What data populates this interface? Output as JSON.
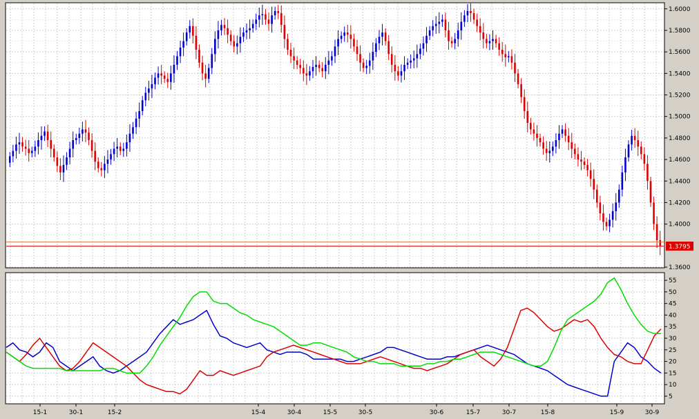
{
  "chart_data": [
    {
      "type": "candlestick",
      "title": "",
      "ylim": [
        1.36,
        1.605
      ],
      "yticks": [
        "1.6000",
        "1.5800",
        "1.5600",
        "1.5400",
        "1.5200",
        "1.5000",
        "1.4800",
        "1.4600",
        "1.4400",
        "1.4200",
        "1.4000",
        "1.3600"
      ],
      "ytick_values": [
        1.6,
        1.58,
        1.56,
        1.54,
        1.52,
        1.5,
        1.48,
        1.46,
        1.44,
        1.42,
        1.4,
        1.36
      ],
      "last_price_label": "1.3795",
      "last_price": 1.3795,
      "grid": true,
      "colors": {
        "up": "#0000cc",
        "down": "#dd0000",
        "last_line": "#dd0000"
      },
      "close_series": [
        1.463,
        1.468,
        1.474,
        1.476,
        1.472,
        1.47,
        1.466,
        1.468,
        1.472,
        1.478,
        1.482,
        1.486,
        1.478,
        1.47,
        1.462,
        1.454,
        1.448,
        1.455,
        1.462,
        1.47,
        1.478,
        1.48,
        1.484,
        1.488,
        1.485,
        1.478,
        1.468,
        1.458,
        1.452,
        1.45,
        1.456,
        1.46,
        1.465,
        1.47,
        1.472,
        1.468,
        1.47,
        1.476,
        1.484,
        1.49,
        1.498,
        1.505,
        1.515,
        1.522,
        1.526,
        1.53,
        1.536,
        1.54,
        1.538,
        1.535,
        1.532,
        1.54,
        1.548,
        1.556,
        1.564,
        1.57,
        1.578,
        1.584,
        1.575,
        1.562,
        1.55,
        1.54,
        1.535,
        1.545,
        1.558,
        1.572,
        1.58,
        1.585,
        1.582,
        1.576,
        1.57,
        1.565,
        1.568,
        1.574,
        1.578,
        1.58,
        1.582,
        1.586,
        1.59,
        1.594,
        1.595,
        1.59,
        1.586,
        1.594,
        1.598,
        1.596,
        1.585,
        1.572,
        1.562,
        1.556,
        1.552,
        1.548,
        1.545,
        1.54,
        1.538,
        1.542,
        1.546,
        1.548,
        1.545,
        1.542,
        1.548,
        1.552,
        1.556,
        1.565,
        1.572,
        1.575,
        1.578,
        1.576,
        1.572,
        1.565,
        1.558,
        1.55,
        1.545,
        1.547,
        1.552,
        1.56,
        1.568,
        1.574,
        1.578,
        1.57,
        1.558,
        1.548,
        1.542,
        1.538,
        1.542,
        1.548,
        1.55,
        1.552,
        1.554,
        1.558,
        1.563,
        1.568,
        1.575,
        1.58,
        1.584,
        1.586,
        1.588,
        1.59,
        1.58,
        1.57,
        1.568,
        1.572,
        1.58,
        1.588,
        1.594,
        1.598,
        1.596,
        1.59,
        1.584,
        1.578,
        1.572,
        1.568,
        1.57,
        1.572,
        1.568,
        1.562,
        1.558,
        1.555,
        1.556,
        1.55,
        1.54,
        1.53,
        1.518,
        1.505,
        1.494,
        1.488,
        1.484,
        1.48,
        1.476,
        1.47,
        1.466,
        1.468,
        1.472,
        1.478,
        1.484,
        1.488,
        1.482,
        1.476,
        1.47,
        1.465,
        1.46,
        1.458,
        1.455,
        1.45,
        1.442,
        1.432,
        1.42,
        1.41,
        1.402,
        1.398,
        1.404,
        1.412,
        1.42,
        1.432,
        1.448,
        1.462,
        1.474,
        1.482,
        1.478,
        1.472,
        1.465,
        1.456,
        1.44,
        1.42,
        1.4,
        1.385,
        1.38
      ]
    },
    {
      "type": "line",
      "title": "",
      "ylim": [
        2,
        58
      ],
      "yticks": [
        "55",
        "50",
        "45",
        "40",
        "35",
        "30",
        "25",
        "20",
        "15",
        "10",
        "5"
      ],
      "ytick_values": [
        55,
        50,
        45,
        40,
        35,
        30,
        25,
        20,
        15,
        10,
        5
      ],
      "x_categories": [
        "15-1",
        "30-1",
        "15-2",
        "15-4",
        "30-4",
        "15-5",
        "30-5",
        "30-6",
        "15-7",
        "30-7",
        "15-8",
        "15-9",
        "30-9"
      ],
      "grid": true,
      "series": [
        {
          "color": "#0000cc",
          "values": [
            26,
            28,
            25,
            24,
            22,
            24,
            28,
            26,
            20,
            18,
            16,
            18,
            20,
            22,
            18,
            16,
            15,
            16,
            18,
            20,
            22,
            24,
            28,
            32,
            35,
            38,
            36,
            37,
            38,
            40,
            42,
            36,
            31,
            30,
            28,
            27,
            26,
            27,
            28,
            25,
            24,
            23,
            24,
            24,
            24,
            23,
            21,
            21,
            21,
            21,
            21,
            20,
            20,
            21,
            22,
            23,
            24,
            26,
            26,
            25,
            24,
            23,
            22,
            21,
            21,
            21,
            22,
            22,
            23,
            24,
            25,
            26,
            27,
            26,
            25,
            24,
            23,
            21,
            19,
            18,
            17,
            16,
            14,
            12,
            10,
            9,
            8,
            7,
            6,
            5,
            5,
            20,
            24,
            28,
            26,
            22,
            20,
            17,
            15
          ]
        },
        {
          "color": "#dd0000",
          "values": [
            24,
            22,
            20,
            23,
            27,
            30,
            26,
            22,
            18,
            16,
            17,
            20,
            24,
            28,
            26,
            24,
            22,
            20,
            18,
            15,
            12,
            10,
            9,
            8,
            7,
            7,
            6,
            8,
            12,
            16,
            14,
            14,
            16,
            15,
            14,
            15,
            16,
            17,
            18,
            22,
            24,
            25,
            26,
            27,
            26,
            25,
            24,
            23,
            22,
            21,
            20,
            19,
            19,
            19,
            20,
            21,
            22,
            21,
            20,
            19,
            18,
            17,
            17,
            16,
            17,
            18,
            19,
            21,
            23,
            24,
            25,
            22,
            20,
            18,
            21,
            26,
            34,
            42,
            43,
            41,
            38,
            35,
            33,
            34,
            36,
            38,
            37,
            38,
            35,
            30,
            26,
            23,
            22,
            20,
            19,
            19,
            25,
            31,
            34
          ]
        },
        {
          "color": "#00dd00",
          "values": [
            24,
            22,
            20,
            18,
            17,
            17,
            17,
            17,
            17,
            16,
            16,
            16,
            16,
            16,
            16,
            17,
            17,
            16,
            15,
            15,
            15,
            18,
            22,
            27,
            31,
            35,
            39,
            44,
            48,
            50,
            50,
            46,
            45,
            45,
            43,
            41,
            40,
            38,
            37,
            36,
            35,
            33,
            31,
            29,
            27,
            27,
            28,
            28,
            27,
            26,
            25,
            24,
            22,
            21,
            20,
            20,
            19,
            19,
            19,
            18,
            18,
            18,
            18,
            19,
            19,
            20,
            20,
            21,
            21,
            22,
            23,
            24,
            24,
            24,
            23,
            22,
            21,
            20,
            19,
            18,
            18,
            20,
            26,
            33,
            38,
            40,
            42,
            44,
            46,
            49,
            54,
            56,
            51,
            45,
            40,
            36,
            33,
            32,
            32
          ]
        }
      ]
    }
  ]
}
